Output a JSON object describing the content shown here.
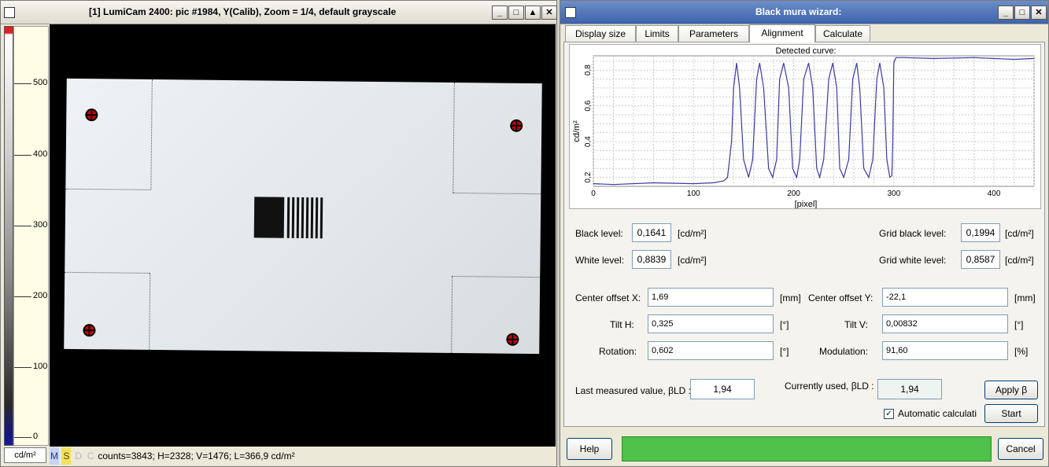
{
  "left_window": {
    "title": "[1] LumiCam 2400: pic #1984, Y(Calib), Zoom = 1/4, default grayscale",
    "buttons": {
      "minimize": "_",
      "maximize": "□",
      "up": "▲",
      "close": "✕"
    },
    "scale": {
      "ticks": [
        "500",
        "400",
        "300",
        "200",
        "100",
        "0"
      ],
      "unit": "cd/m²"
    },
    "status": {
      "letters": [
        "M",
        "S",
        "D",
        "C"
      ],
      "text": "counts=3843; H=2328; V=1476; L=366,9 cd/m²"
    }
  },
  "right_window": {
    "title": "Black mura wizard:",
    "buttons": {
      "minimize": "_",
      "maximize": "□",
      "close": "✕"
    },
    "tabs": [
      "Display size",
      "Limits",
      "Parameters",
      "Alignment",
      "Calculate"
    ],
    "active_tab": "Alignment",
    "chart_data": {
      "type": "line",
      "title": "Detected curve:",
      "xlabel": "[pixel]",
      "ylabel": "cd/m²",
      "xlim": [
        0,
        440
      ],
      "ylim": [
        0.15,
        0.88
      ],
      "xticks": [
        "0",
        "100",
        "200",
        "300",
        "400"
      ],
      "yticks": [
        "0,2",
        "0,4",
        "0,6",
        "0,8"
      ],
      "grid": true,
      "color": "#3a3aa8",
      "series": [
        {
          "x": [
            0,
            20,
            60,
            100,
            120,
            130,
            134,
            138,
            140,
            143,
            146,
            150,
            155,
            159,
            163,
            166,
            170,
            175,
            179,
            183,
            186,
            190,
            195,
            199,
            203,
            206,
            210,
            215,
            219,
            223,
            226,
            230,
            235,
            239,
            243,
            246,
            250,
            255,
            259,
            263,
            266,
            270,
            275,
            279,
            283,
            286,
            290,
            293,
            296,
            298,
            299,
            300,
            302,
            310,
            340,
            380,
            420,
            440
          ],
          "y": [
            0.165,
            0.16,
            0.17,
            0.165,
            0.17,
            0.18,
            0.2,
            0.4,
            0.7,
            0.84,
            0.7,
            0.3,
            0.2,
            0.3,
            0.75,
            0.84,
            0.7,
            0.25,
            0.2,
            0.3,
            0.75,
            0.84,
            0.7,
            0.25,
            0.2,
            0.3,
            0.75,
            0.84,
            0.7,
            0.25,
            0.2,
            0.3,
            0.75,
            0.84,
            0.7,
            0.25,
            0.2,
            0.3,
            0.75,
            0.84,
            0.7,
            0.25,
            0.2,
            0.3,
            0.75,
            0.84,
            0.7,
            0.3,
            0.2,
            0.21,
            0.4,
            0.84,
            0.87,
            0.87,
            0.865,
            0.87,
            0.86,
            0.865
          ]
        }
      ]
    },
    "fields": {
      "black_level": {
        "label": "Black level:",
        "value": "0,1641",
        "unit": "[cd/m²]"
      },
      "white_level": {
        "label": "White level:",
        "value": "0,8839",
        "unit": "[cd/m²]"
      },
      "grid_black_level": {
        "label": "Grid black level:",
        "value": "0,1994",
        "unit": "[cd/m²]"
      },
      "grid_white_level": {
        "label": "Grid white level:",
        "value": "0,8587",
        "unit": "[cd/m²]"
      },
      "center_offset_x": {
        "label": "Center offset X:",
        "value": "1,69",
        "unit": "[mm]"
      },
      "center_offset_y": {
        "label": "Center offset Y:",
        "value": "-22,1",
        "unit": "[mm]"
      },
      "tilt_h": {
        "label": "Tilt H:",
        "value": "0,325",
        "unit": "[°]"
      },
      "tilt_v": {
        "label": "Tilt V:",
        "value": "0,00832",
        "unit": "[°]"
      },
      "rotation": {
        "label": "Rotation:",
        "value": "0,602",
        "unit": "[°]"
      },
      "modulation": {
        "label": "Modulation:",
        "value": "91,60",
        "unit": "[%]"
      },
      "last_measured": {
        "label": "Last measured value, βLD :",
        "value": "1,94"
      },
      "currently_used": {
        "label": "Currently used, βLD :",
        "value": "1,94"
      }
    },
    "apply_button": "Apply β",
    "auto_calc_label": "Automatic calculati",
    "auto_calc_checked": "✓",
    "start_button": "Start",
    "help_button": "Help",
    "cancel_button": "Cancel",
    "progress_fraction": 1.0
  }
}
